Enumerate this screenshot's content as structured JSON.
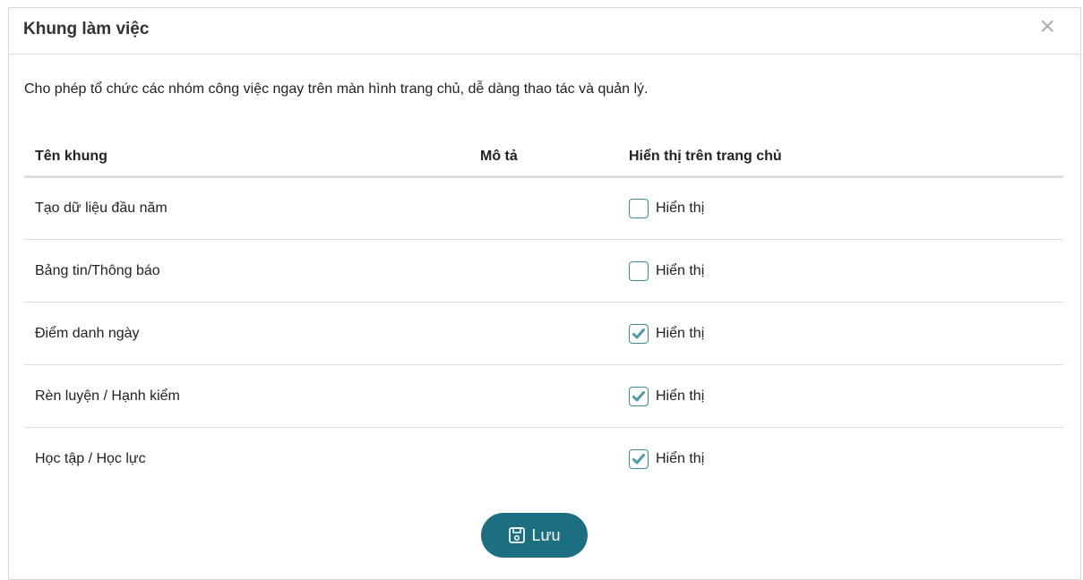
{
  "dialog": {
    "title": "Khung làm việc",
    "close_glyph": "×",
    "description": "Cho phép tổ chức các nhóm công việc ngay trên màn hình trang chủ, dễ dàng thao tác và quản lý."
  },
  "table": {
    "headers": {
      "name": "Tên khung",
      "description": "Mô tả",
      "show": "Hiển thị trên trang chủ"
    },
    "rows": [
      {
        "name": "Tạo dữ liệu đầu năm",
        "description": "",
        "checkbox_label": "Hiển thị",
        "checked": false
      },
      {
        "name": "Bảng tin/Thông báo",
        "description": "",
        "checkbox_label": "Hiển thị",
        "checked": false
      },
      {
        "name": "Điểm danh ngày",
        "description": "",
        "checkbox_label": "Hiển thị",
        "checked": true
      },
      {
        "name": "Rèn luyện / Hạnh kiểm",
        "description": "",
        "checkbox_label": "Hiển thị",
        "checked": true
      },
      {
        "name": "Học tập / Học lực",
        "description": "",
        "checkbox_label": "Hiển thị",
        "checked": true
      }
    ]
  },
  "footer": {
    "save_label": "Lưu",
    "save_icon": "floppy-disk-icon"
  },
  "colors": {
    "accent": "#1c6f80",
    "checkbox_border": "#3d8a95",
    "checkmark": "#4f9aa5"
  }
}
